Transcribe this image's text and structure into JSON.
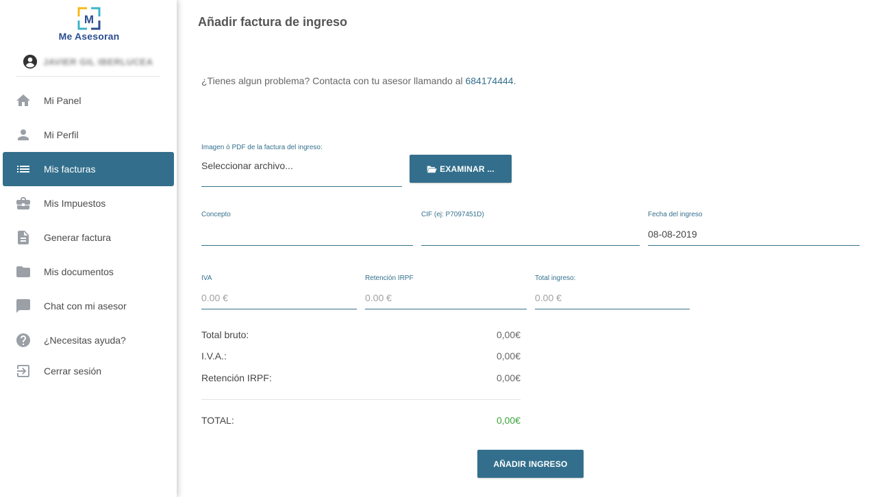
{
  "sidebar": {
    "brand": "Me Asesoran",
    "logo_letter": "M",
    "user_name": "JAVIER GIL IBERLUCEA",
    "items": [
      {
        "label": "Mi Panel",
        "icon": "home-icon"
      },
      {
        "label": "Mi Perfil",
        "icon": "person-icon"
      },
      {
        "label": "Mis facturas",
        "icon": "list-icon",
        "active": true
      },
      {
        "label": "Mis Impuestos",
        "icon": "briefcase-icon"
      },
      {
        "label": "Generar factura",
        "icon": "document-icon"
      },
      {
        "label": "Mis documentos",
        "icon": "folder-icon"
      },
      {
        "label": "Chat con mi asesor",
        "icon": "chat-icon"
      },
      {
        "label": "¿Necesitas ayuda?",
        "icon": "help-icon"
      },
      {
        "label": "Cerrar sesión",
        "icon": "logout-icon"
      }
    ]
  },
  "main": {
    "title": "Añadir factura de ingreso",
    "contact_text": "¿Tienes algun problema? Contacta con tu asesor llamando al ",
    "contact_phone": "684174444",
    "contact_suffix": ".",
    "file": {
      "label": "Imagen ó PDF de la factura del ingreso:",
      "placeholder": "Seleccionar archivo...",
      "browse_label": "EXAMINAR ..."
    },
    "concepto": {
      "label": "Concepto",
      "value": ""
    },
    "cif": {
      "label": "CIF (ej: P7097451D)",
      "value": ""
    },
    "fecha": {
      "label": "Fecha del ingreso",
      "value": "08-08-2019"
    },
    "iva": {
      "label": "IVA",
      "placeholder": "0.00 €"
    },
    "retencion": {
      "label": "Retención IRPF",
      "placeholder": "0.00 €"
    },
    "total_ingreso": {
      "label": "Total ingreso:",
      "placeholder": "0.00 €"
    },
    "summary": {
      "total_bruto_label": "Total bruto:",
      "total_bruto_value": "0,00€",
      "iva_label": "I.V.A.:",
      "iva_value": "0,00€",
      "retencion_label": "Retención IRPF:",
      "retencion_value": "0,00€",
      "total_label": "TOTAL:",
      "total_value": "0,00€"
    },
    "submit_label": "AÑADIR INGRESO"
  },
  "colors": {
    "accent": "#336f8c",
    "total_green": "#3aa33a",
    "logo_yellow": "#f5b81a",
    "logo_blue": "#2b4e8f",
    "logo_cyan": "#3cb4c8"
  }
}
